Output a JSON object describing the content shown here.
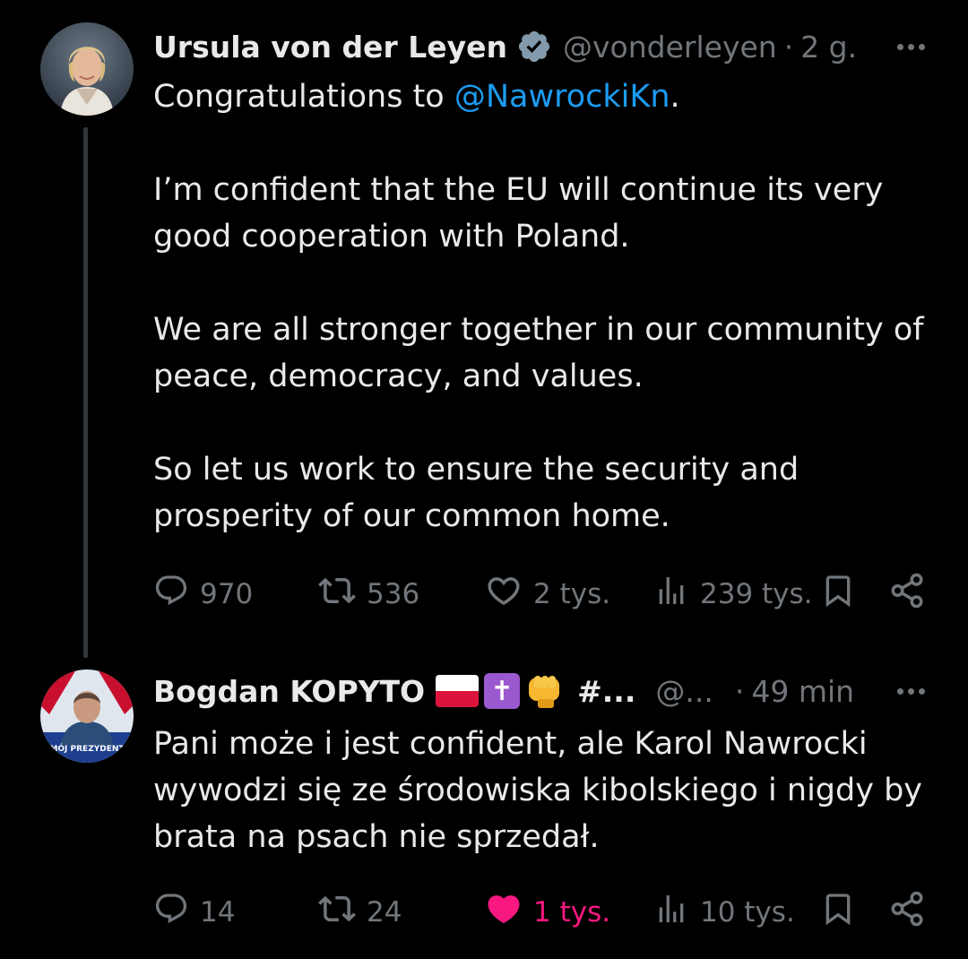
{
  "tweets": [
    {
      "author_name": "Ursula von der Leyen",
      "handle": "@vonderleyen",
      "separator": "·",
      "time": "2 g.",
      "body": {
        "p1_prefix": "Congratulations to ",
        "p1_mention": "@NawrockiKn",
        "p1_suffix": ".",
        "p2": "I’m confident that the EU will continue its very good cooperation with Poland.",
        "p3": "We are all stronger together in our community of peace, democracy, and values.",
        "p4": "So let us work to ensure the security and prosperity of our common home."
      },
      "stats": {
        "replies": "970",
        "reposts": "536",
        "likes": "2 tys.",
        "views": "239 tys."
      },
      "liked": false
    },
    {
      "author_name": "Bogdan KOPYTO",
      "name_suffix": "#...",
      "handle": "@...",
      "separator": "·",
      "time": "49 min",
      "avatar_caption": "MÓJ PREZYDENT",
      "body": {
        "text": "Pani może i jest confident, ale Karol Nawrocki wywodzi się ze środowiska kibolskiego i nigdy by brata na psach nie sprzedał."
      },
      "stats": {
        "replies": "14",
        "reposts": "24",
        "likes": "1 tys.",
        "views": "10 tys."
      },
      "liked": true
    }
  ],
  "colors": {
    "background": "#000000",
    "text": "#e7e9ea",
    "muted": "#71767b",
    "link": "#1d9bf0",
    "like_active": "#f91880",
    "verified": "#829aab"
  },
  "icons": [
    "verified-badge-icon",
    "more-icon",
    "reply-icon",
    "repost-icon",
    "like-icon",
    "views-icon",
    "bookmark-icon",
    "share-icon",
    "poland-flag-icon",
    "cross-icon",
    "fist-icon"
  ]
}
